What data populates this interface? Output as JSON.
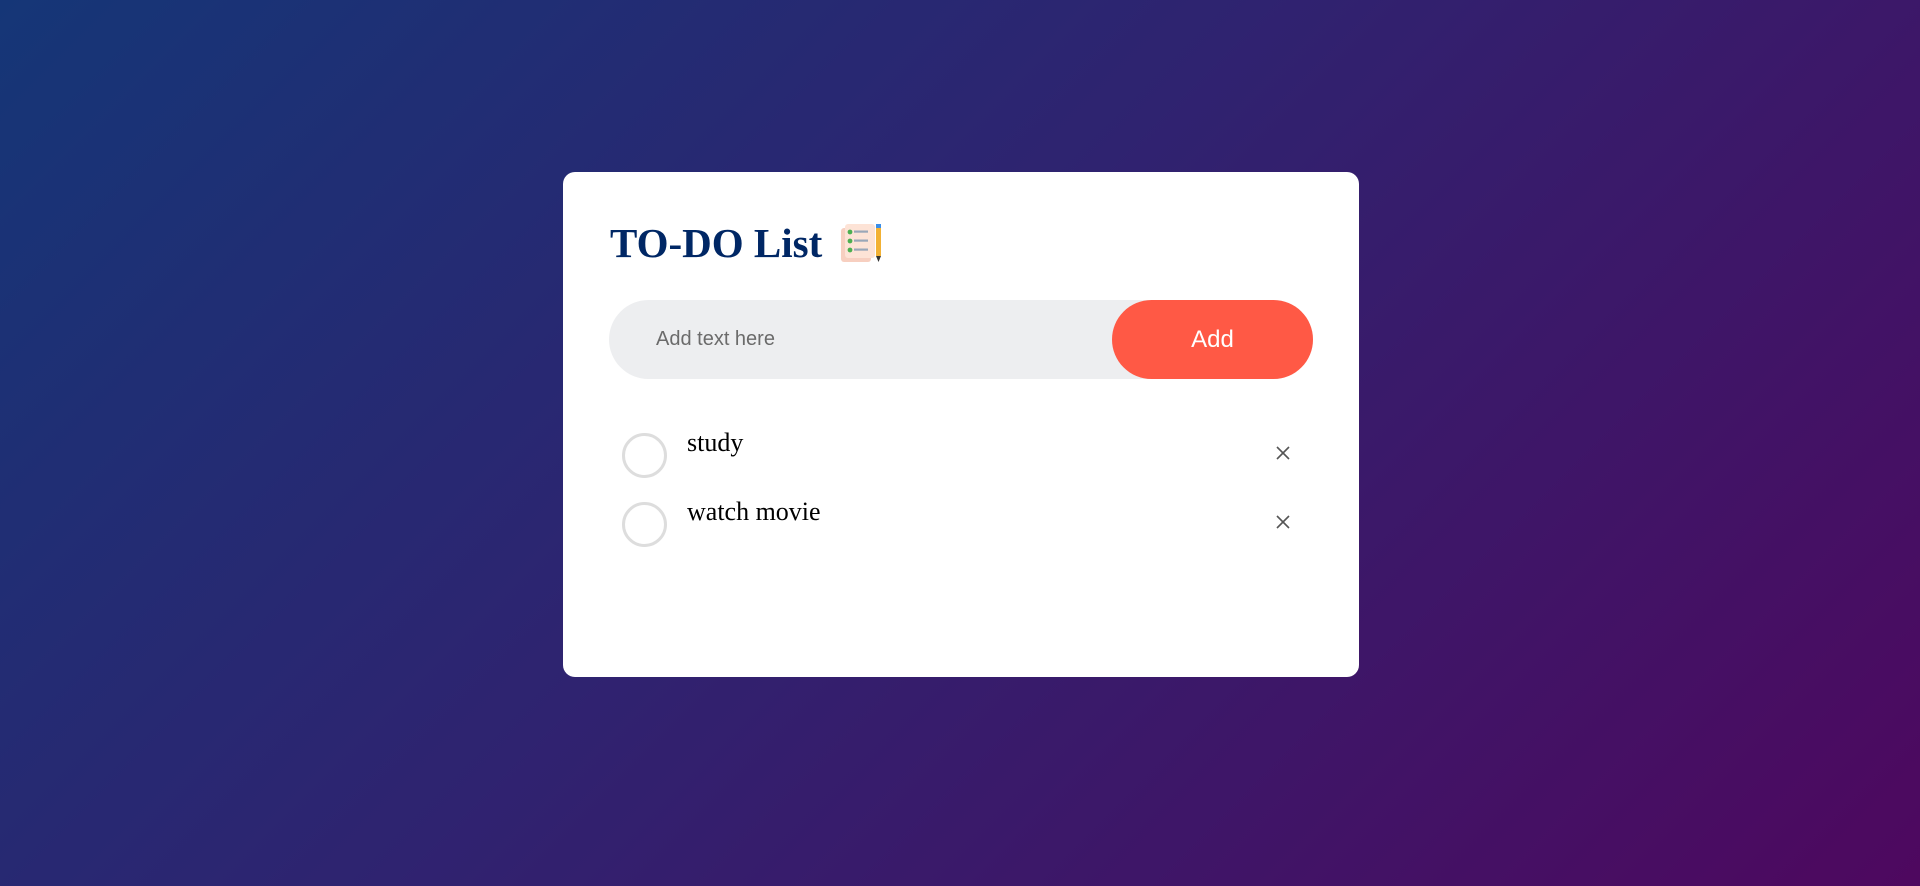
{
  "app": {
    "title": "TO-DO List",
    "title_icon": "checklist-notepad-icon"
  },
  "input": {
    "placeholder": "Add text here",
    "value": ""
  },
  "add_button": {
    "label": "Add",
    "color": "#ff5945"
  },
  "tasks": [
    {
      "text": "study",
      "checked": false
    },
    {
      "text": "watch movie",
      "checked": false
    }
  ],
  "colors": {
    "title": "#002765",
    "background_start": "#153677",
    "background_end": "#4e085f"
  }
}
